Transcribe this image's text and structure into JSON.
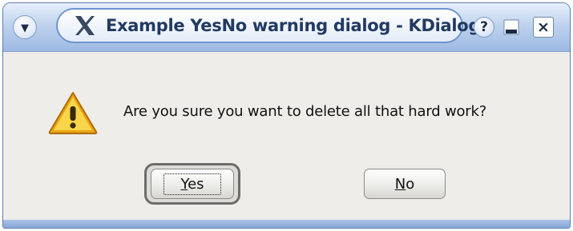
{
  "window": {
    "title": "Example YesNo warning dialog - KDialog",
    "titlebar_buttons": {
      "menu_icon": "chevron-down-icon",
      "help_label": "?",
      "minimize_icon": "minimize-icon",
      "close_label": "×"
    }
  },
  "dialog": {
    "icon": "warning-icon",
    "message": "Are you sure you want to delete all that hard work?",
    "buttons": {
      "yes": {
        "mnemonic": "Y",
        "rest": "es"
      },
      "no": {
        "mnemonic": "N",
        "rest": "o"
      }
    }
  },
  "colors": {
    "titlebar_accent": "#9db9e2",
    "dialog_background": "#eeedea",
    "warning_fill": "#f7c52a"
  }
}
